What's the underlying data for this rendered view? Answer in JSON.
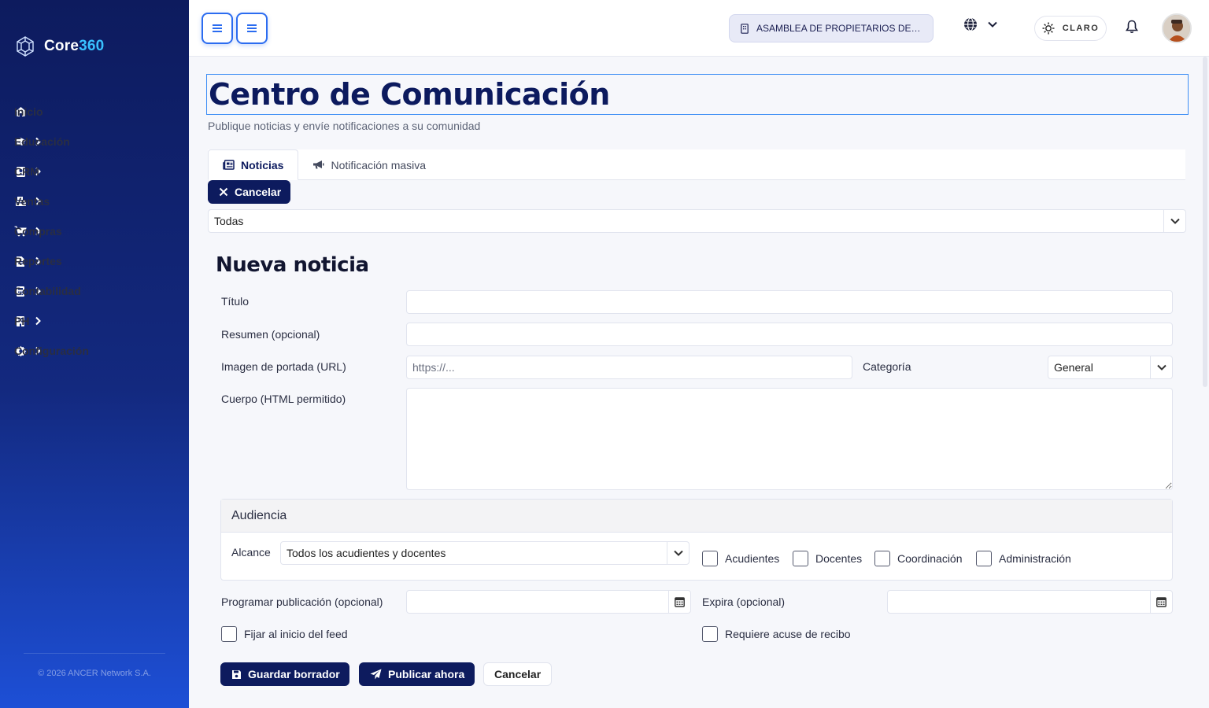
{
  "brand": {
    "name_main": "Core",
    "name_accent": "360"
  },
  "sidebar": {
    "items": [
      {
        "label": "Inicio",
        "icon": "home-icon",
        "has_children": false
      },
      {
        "label": "Educación",
        "icon": "graduation-cap-icon",
        "has_children": true
      },
      {
        "label": "CRM",
        "icon": "address-book-icon",
        "has_children": true
      },
      {
        "label": "Ventas",
        "icon": "cash-register-icon",
        "has_children": true
      },
      {
        "label": "Compras",
        "icon": "shopping-cart-icon",
        "has_children": true
      },
      {
        "label": "Reportes",
        "icon": "file-icon",
        "has_children": true
      },
      {
        "label": "Contabilidad",
        "icon": "calculator-icon",
        "has_children": true
      },
      {
        "label": "PH",
        "icon": "building-icon",
        "has_children": true
      },
      {
        "label": "Configuración",
        "icon": "gear-icon",
        "has_children": true
      }
    ],
    "footer": "© 2026 ANCER Network S.A."
  },
  "topbar": {
    "organization": "ASAMBLEA DE PROPIETARIOS DE LA PROPIEDAD HORIZONTAL",
    "theme_label": "CLARO"
  },
  "page": {
    "title": "Centro de Comunicación",
    "subtitle": "Publique noticias y envíe notificaciones a su comunidad",
    "tabs": [
      {
        "label": "Noticias",
        "active": true
      },
      {
        "label": "Notificación masiva",
        "active": false
      }
    ],
    "cancel_top_label": "Cancelar",
    "filter_value": "Todas"
  },
  "form": {
    "title": "Nueva noticia",
    "titulo_label": "Título",
    "titulo_value": "",
    "resumen_label": "Resumen (opcional)",
    "resumen_value": "",
    "imagen_label": "Imagen de portada (URL)",
    "imagen_placeholder": "https://...",
    "categoria_label": "Categoría",
    "categoria_value": "General",
    "cuerpo_label": "Cuerpo (HTML permitido)",
    "cuerpo_value": "",
    "audiencia": {
      "heading": "Audiencia",
      "alcance_label": "Alcance",
      "alcance_value": "Todos los acudientes y docentes",
      "options": [
        "Acudientes",
        "Docentes",
        "Coordinación",
        "Administración"
      ]
    },
    "programar_label": "Programar publicación (opcional)",
    "programar_value": "",
    "expira_label": "Expira (opcional)",
    "expira_value": "",
    "fijar_label": "Fijar al inicio del feed",
    "acuse_label": "Requiere acuse de recibo",
    "save_label": "Guardar borrador",
    "publish_label": "Publicar ahora",
    "cancel_label": "Cancelar"
  },
  "colors": {
    "sidebar_top": "#0d1b5e",
    "sidebar_bottom": "#1d4fd6",
    "accent": "#39c2ff",
    "primary_button": "#0d1b5e",
    "focus_border": "#3f8ff5"
  }
}
